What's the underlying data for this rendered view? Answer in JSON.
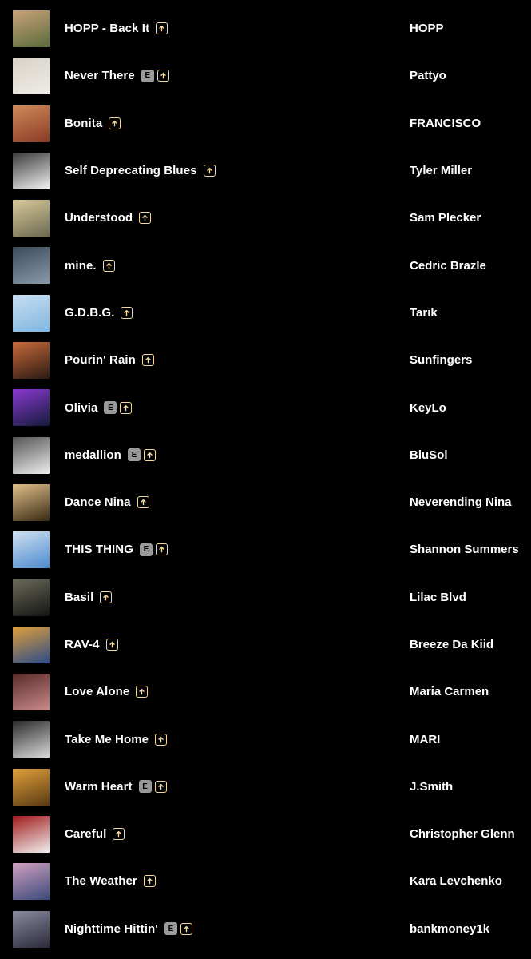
{
  "colors": {
    "background": "#000000",
    "text": "#ffffff",
    "boost_accent": "#f2d7a0",
    "explicit_badge_bg": "#9a9a9a"
  },
  "explicit_label": "E",
  "tracks": [
    {
      "title": "HOPP - Back It",
      "artist": "HOPP",
      "explicit": false,
      "art": [
        "#5a6b3a",
        "#c9a27a"
      ]
    },
    {
      "title": "Never There",
      "artist": "Pattyo",
      "explicit": true,
      "art": [
        "#efece6",
        "#d8d3c9"
      ]
    },
    {
      "title": "Bonita",
      "artist": "FRANCISCO",
      "explicit": false,
      "art": [
        "#8a3a25",
        "#d08a5a"
      ]
    },
    {
      "title": "Self Deprecating Blues",
      "artist": "Tyler Miller",
      "explicit": false,
      "art": [
        "#f2f2f2",
        "#3a3a3a"
      ]
    },
    {
      "title": "Understood",
      "artist": "Sam Plecker",
      "explicit": false,
      "art": [
        "#6c6a52",
        "#d8c89a"
      ]
    },
    {
      "title": "mine.",
      "artist": "Cedric Brazle",
      "explicit": false,
      "art": [
        "#8a9aaa",
        "#3a4a5a"
      ]
    },
    {
      "title": "G.D.B.G.",
      "artist": "Tarık",
      "explicit": false,
      "art": [
        "#7fb6e0",
        "#c9def0"
      ]
    },
    {
      "title": "Pourin' Rain",
      "artist": "Sunfingers",
      "explicit": false,
      "art": [
        "#2a1a14",
        "#c96a3a"
      ]
    },
    {
      "title": "Olivia",
      "artist": "KeyLo",
      "explicit": true,
      "art": [
        "#141a3a",
        "#8a3ad0"
      ]
    },
    {
      "title": "medallion",
      "artist": "BluSol",
      "explicit": true,
      "art": [
        "#eeeeee",
        "#555555"
      ]
    },
    {
      "title": "Dance Nina",
      "artist": "Neverending Nina",
      "explicit": false,
      "art": [
        "#3a2a14",
        "#e0c08a"
      ]
    },
    {
      "title": "THIS THING",
      "artist": "Shannon Summers",
      "explicit": true,
      "art": [
        "#4a8ad0",
        "#d0e0f0"
      ]
    },
    {
      "title": "Basil",
      "artist": "Lilac Blvd",
      "explicit": false,
      "art": [
        "#141414",
        "#6a6a5a"
      ]
    },
    {
      "title": "RAV-4",
      "artist": "Breeze Da Kiid",
      "explicit": false,
      "art": [
        "#2a4a8a",
        "#e0a03a"
      ]
    },
    {
      "title": "Love Alone",
      "artist": "Maria Carmen",
      "explicit": false,
      "art": [
        "#c98a8a",
        "#5a2a2a"
      ]
    },
    {
      "title": "Take Me Home",
      "artist": "MARI",
      "explicit": false,
      "art": [
        "#dadada",
        "#2a2a2a"
      ]
    },
    {
      "title": "Warm Heart",
      "artist": "J.Smith",
      "explicit": true,
      "art": [
        "#5a3a14",
        "#e0a03a"
      ]
    },
    {
      "title": "Careful",
      "artist": "Christopher Glenn",
      "explicit": false,
      "art": [
        "#f0f0f0",
        "#a01a1a"
      ]
    },
    {
      "title": "The Weather",
      "artist": "Kara Levchenko",
      "explicit": false,
      "art": [
        "#3a4a7a",
        "#d0a0c0"
      ]
    },
    {
      "title": "Nighttime Hittin'",
      "artist": "bankmoney1k",
      "explicit": true,
      "art": [
        "#2a2a3a",
        "#8a8aa0"
      ]
    }
  ]
}
